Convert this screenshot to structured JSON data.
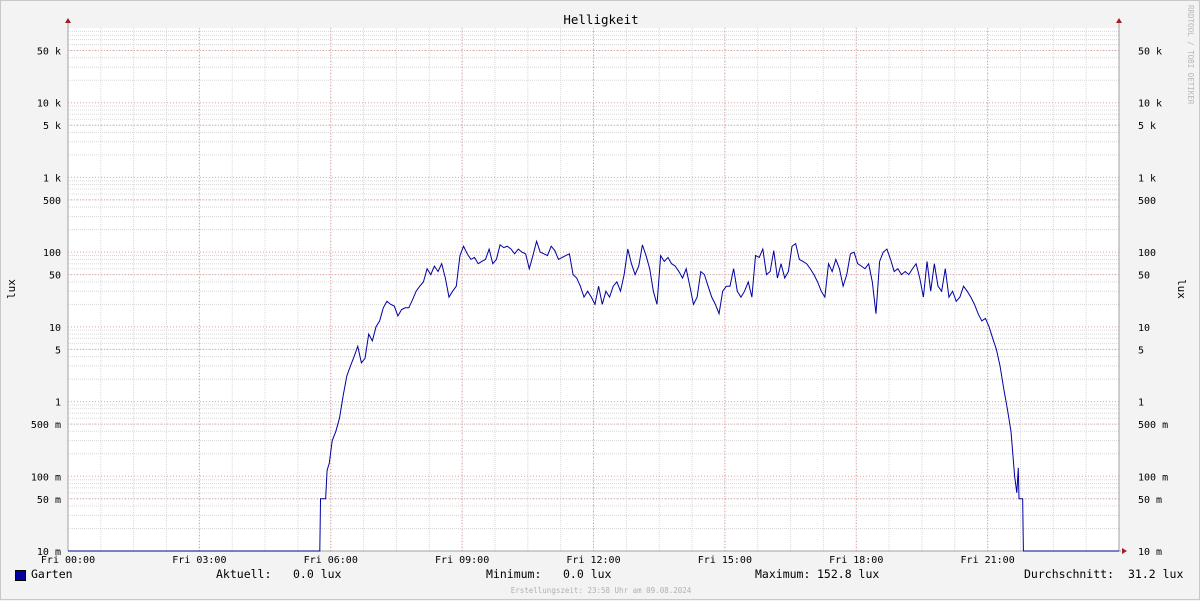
{
  "chart_data": {
    "type": "line",
    "title": "Helligkeit",
    "ylabel": "lux",
    "yscale": "log",
    "ylim": [
      0.01,
      100000
    ],
    "xlim": [
      "Fri 00:00",
      "Sat 00:00"
    ],
    "x_ticks": [
      "Fri 00:00",
      "Fri 03:00",
      "Fri 06:00",
      "Fri 09:00",
      "Fri 12:00",
      "Fri 15:00",
      "Fri 18:00",
      "Fri 21:00"
    ],
    "y_ticks": [
      {
        "value": 0.01,
        "label": "10 m"
      },
      {
        "value": 0.05,
        "label": "50 m"
      },
      {
        "value": 0.1,
        "label": "100 m"
      },
      {
        "value": 0.5,
        "label": "500 m"
      },
      {
        "value": 1,
        "label": "1"
      },
      {
        "value": 5,
        "label": "5"
      },
      {
        "value": 10,
        "label": "10"
      },
      {
        "value": 50,
        "label": "50"
      },
      {
        "value": 100,
        "label": "100"
      },
      {
        "value": 500,
        "label": "500"
      },
      {
        "value": 1000,
        "label": "1 k"
      },
      {
        "value": 5000,
        "label": "5 k"
      },
      {
        "value": 10000,
        "label": "10 k"
      },
      {
        "value": 50000,
        "label": "50 k"
      }
    ],
    "grid": true,
    "series": [
      {
        "name": "Garten",
        "color": "#0000a0",
        "points": [
          [
            "Fri 00:00",
            0.01
          ],
          [
            "Fri 03:00",
            0.01
          ],
          [
            "Fri 05:45",
            0.01
          ],
          [
            "Fri 05:46",
            0.05
          ],
          [
            "Fri 05:53",
            0.05
          ],
          [
            "Fri 05:55",
            0.12
          ],
          [
            "Fri 05:58",
            0.15
          ],
          [
            "Fri 06:02",
            0.3
          ],
          [
            "Fri 06:07",
            0.4
          ],
          [
            "Fri 06:12",
            0.6
          ],
          [
            "Fri 06:17",
            1.2
          ],
          [
            "Fri 06:22",
            2.2
          ],
          [
            "Fri 06:27",
            3.0
          ],
          [
            "Fri 06:32",
            4.0
          ],
          [
            "Fri 06:37",
            5.5
          ],
          [
            "Fri 06:42",
            3.3
          ],
          [
            "Fri 06:47",
            3.8
          ],
          [
            "Fri 06:52",
            8.0
          ],
          [
            "Fri 06:57",
            6.5
          ],
          [
            "Fri 07:02",
            10.0
          ],
          [
            "Fri 07:07",
            12.0
          ],
          [
            "Fri 07:12",
            18.0
          ],
          [
            "Fri 07:17",
            22.0
          ],
          [
            "Fri 07:22",
            20.0
          ],
          [
            "Fri 07:27",
            19.0
          ],
          [
            "Fri 07:32",
            14.0
          ],
          [
            "Fri 07:37",
            17.0
          ],
          [
            "Fri 07:42",
            18.0
          ],
          [
            "Fri 07:47",
            18.0
          ],
          [
            "Fri 07:52",
            23.0
          ],
          [
            "Fri 07:57",
            30.0
          ],
          [
            "Fri 08:02",
            35.0
          ],
          [
            "Fri 08:07",
            40.0
          ],
          [
            "Fri 08:12",
            60.0
          ],
          [
            "Fri 08:17",
            50.0
          ],
          [
            "Fri 08:22",
            65.0
          ],
          [
            "Fri 08:27",
            55.0
          ],
          [
            "Fri 08:32",
            70.0
          ],
          [
            "Fri 08:37",
            45.0
          ],
          [
            "Fri 08:42",
            25.0
          ],
          [
            "Fri 08:47",
            30.0
          ],
          [
            "Fri 08:52",
            35.0
          ],
          [
            "Fri 08:57",
            90.0
          ],
          [
            "Fri 09:02",
            120.0
          ],
          [
            "Fri 09:07",
            95.0
          ],
          [
            "Fri 09:12",
            80.0
          ],
          [
            "Fri 09:17",
            85.0
          ],
          [
            "Fri 09:22",
            70.0
          ],
          [
            "Fri 09:27",
            75.0
          ],
          [
            "Fri 09:32",
            80.0
          ],
          [
            "Fri 09:37",
            110.0
          ],
          [
            "Fri 09:42",
            70.0
          ],
          [
            "Fri 09:47",
            80.0
          ],
          [
            "Fri 09:52",
            125.0
          ],
          [
            "Fri 09:57",
            115.0
          ],
          [
            "Fri 10:02",
            120.0
          ],
          [
            "Fri 10:07",
            110.0
          ],
          [
            "Fri 10:12",
            95.0
          ],
          [
            "Fri 10:17",
            110.0
          ],
          [
            "Fri 10:22",
            100.0
          ],
          [
            "Fri 10:27",
            95.0
          ],
          [
            "Fri 10:32",
            60.0
          ],
          [
            "Fri 10:37",
            90.0
          ],
          [
            "Fri 10:42",
            140.0
          ],
          [
            "Fri 10:47",
            100.0
          ],
          [
            "Fri 10:52",
            95.0
          ],
          [
            "Fri 10:57",
            90.0
          ],
          [
            "Fri 11:02",
            120.0
          ],
          [
            "Fri 11:07",
            105.0
          ],
          [
            "Fri 11:12",
            80.0
          ],
          [
            "Fri 11:17",
            85.0
          ],
          [
            "Fri 11:22",
            90.0
          ],
          [
            "Fri 11:27",
            95.0
          ],
          [
            "Fri 11:32",
            50.0
          ],
          [
            "Fri 11:37",
            45.0
          ],
          [
            "Fri 11:42",
            35.0
          ],
          [
            "Fri 11:47",
            25.0
          ],
          [
            "Fri 11:52",
            30.0
          ],
          [
            "Fri 11:57",
            25.0
          ],
          [
            "Fri 12:02",
            20.0
          ],
          [
            "Fri 12:07",
            35.0
          ],
          [
            "Fri 12:12",
            20.0
          ],
          [
            "Fri 12:17",
            30.0
          ],
          [
            "Fri 12:22",
            25.0
          ],
          [
            "Fri 12:27",
            35.0
          ],
          [
            "Fri 12:32",
            40.0
          ],
          [
            "Fri 12:37",
            30.0
          ],
          [
            "Fri 12:42",
            50.0
          ],
          [
            "Fri 12:47",
            110.0
          ],
          [
            "Fri 12:52",
            70.0
          ],
          [
            "Fri 12:57",
            50.0
          ],
          [
            "Fri 13:02",
            65.0
          ],
          [
            "Fri 13:07",
            125.0
          ],
          [
            "Fri 13:12",
            90.0
          ],
          [
            "Fri 13:17",
            60.0
          ],
          [
            "Fri 13:22",
            30.0
          ],
          [
            "Fri 13:27",
            20.0
          ],
          [
            "Fri 13:32",
            90.0
          ],
          [
            "Fri 13:37",
            75.0
          ],
          [
            "Fri 13:42",
            85.0
          ],
          [
            "Fri 13:47",
            70.0
          ],
          [
            "Fri 13:52",
            65.0
          ],
          [
            "Fri 13:57",
            55.0
          ],
          [
            "Fri 14:02",
            45.0
          ],
          [
            "Fri 14:07",
            60.0
          ],
          [
            "Fri 14:12",
            35.0
          ],
          [
            "Fri 14:17",
            20.0
          ],
          [
            "Fri 14:22",
            25.0
          ],
          [
            "Fri 14:27",
            55.0
          ],
          [
            "Fri 14:32",
            50.0
          ],
          [
            "Fri 14:37",
            35.0
          ],
          [
            "Fri 14:42",
            25.0
          ],
          [
            "Fri 14:47",
            20.0
          ],
          [
            "Fri 14:52",
            15.0
          ],
          [
            "Fri 14:57",
            30.0
          ],
          [
            "Fri 15:02",
            35.0
          ],
          [
            "Fri 15:07",
            35.0
          ],
          [
            "Fri 15:12",
            60.0
          ],
          [
            "Fri 15:17",
            30.0
          ],
          [
            "Fri 15:22",
            25.0
          ],
          [
            "Fri 15:27",
            30.0
          ],
          [
            "Fri 15:32",
            40.0
          ],
          [
            "Fri 15:37",
            25.0
          ],
          [
            "Fri 15:42",
            90.0
          ],
          [
            "Fri 15:47",
            85.0
          ],
          [
            "Fri 15:52",
            110.0
          ],
          [
            "Fri 15:57",
            50.0
          ],
          [
            "Fri 16:02",
            55.0
          ],
          [
            "Fri 16:07",
            105.0
          ],
          [
            "Fri 16:12",
            45.0
          ],
          [
            "Fri 16:17",
            70.0
          ],
          [
            "Fri 16:22",
            45.0
          ],
          [
            "Fri 16:27",
            55.0
          ],
          [
            "Fri 16:32",
            120.0
          ],
          [
            "Fri 16:37",
            130.0
          ],
          [
            "Fri 16:42",
            80.0
          ],
          [
            "Fri 16:47",
            75.0
          ],
          [
            "Fri 16:52",
            70.0
          ],
          [
            "Fri 16:57",
            60.0
          ],
          [
            "Fri 17:02",
            50.0
          ],
          [
            "Fri 17:07",
            40.0
          ],
          [
            "Fri 17:12",
            30.0
          ],
          [
            "Fri 17:17",
            25.0
          ],
          [
            "Fri 17:22",
            70.0
          ],
          [
            "Fri 17:27",
            55.0
          ],
          [
            "Fri 17:32",
            80.0
          ],
          [
            "Fri 17:37",
            60.0
          ],
          [
            "Fri 17:42",
            35.0
          ],
          [
            "Fri 17:47",
            50.0
          ],
          [
            "Fri 17:52",
            95.0
          ],
          [
            "Fri 17:57",
            100.0
          ],
          [
            "Fri 18:02",
            70.0
          ],
          [
            "Fri 18:07",
            65.0
          ],
          [
            "Fri 18:12",
            60.0
          ],
          [
            "Fri 18:17",
            70.0
          ],
          [
            "Fri 18:22",
            40.0
          ],
          [
            "Fri 18:27",
            15.0
          ],
          [
            "Fri 18:32",
            75.0
          ],
          [
            "Fri 18:37",
            100.0
          ],
          [
            "Fri 18:42",
            110.0
          ],
          [
            "Fri 18:47",
            80.0
          ],
          [
            "Fri 18:52",
            55.0
          ],
          [
            "Fri 18:57",
            60.0
          ],
          [
            "Fri 19:02",
            50.0
          ],
          [
            "Fri 19:07",
            55.0
          ],
          [
            "Fri 19:12",
            50.0
          ],
          [
            "Fri 19:17",
            60.0
          ],
          [
            "Fri 19:22",
            70.0
          ],
          [
            "Fri 19:27",
            45.0
          ],
          [
            "Fri 19:32",
            25.0
          ],
          [
            "Fri 19:37",
            75.0
          ],
          [
            "Fri 19:42",
            30.0
          ],
          [
            "Fri 19:47",
            70.0
          ],
          [
            "Fri 19:52",
            35.0
          ],
          [
            "Fri 19:57",
            30.0
          ],
          [
            "Fri 20:02",
            60.0
          ],
          [
            "Fri 20:07",
            25.0
          ],
          [
            "Fri 20:12",
            30.0
          ],
          [
            "Fri 20:17",
            22.0
          ],
          [
            "Fri 20:22",
            25.0
          ],
          [
            "Fri 20:27",
            35.0
          ],
          [
            "Fri 20:32",
            30.0
          ],
          [
            "Fri 20:37",
            25.0
          ],
          [
            "Fri 20:42",
            20.0
          ],
          [
            "Fri 20:47",
            15.0
          ],
          [
            "Fri 20:52",
            12.0
          ],
          [
            "Fri 20:57",
            13.0
          ],
          [
            "Fri 21:02",
            10.0
          ],
          [
            "Fri 21:07",
            7.0
          ],
          [
            "Fri 21:12",
            5.0
          ],
          [
            "Fri 21:17",
            3.0
          ],
          [
            "Fri 21:22",
            1.5
          ],
          [
            "Fri 21:27",
            0.8
          ],
          [
            "Fri 21:32",
            0.4
          ],
          [
            "Fri 21:37",
            0.1
          ],
          [
            "Fri 21:40",
            0.06
          ],
          [
            "Fri 21:42",
            0.13
          ],
          [
            "Fri 21:43",
            0.05
          ],
          [
            "Fri 21:48",
            0.05
          ],
          [
            "Fri 21:49",
            0.01
          ],
          [
            "Sat 00:00",
            0.01
          ]
        ]
      }
    ]
  },
  "legend": {
    "series_name": "Garten",
    "series_color": "#0000a0",
    "current_label": "Aktuell:",
    "current_value": "0.0 lux",
    "min_label": "Minimum:",
    "min_value": "0.0 lux",
    "max_label": "Maximum:",
    "max_value": "152.8 lux",
    "avg_label": "Durchschnitt:",
    "avg_value": "31.2 lux"
  },
  "footer": "Erstellungszeit: 23:58 Uhr am 09.08.2024",
  "watermark": "RRDTOOL / TOBI OETIKER",
  "colors": {
    "background": "#f3f3f3",
    "plot_background": "#ffffff",
    "major_grid": "#e8a0a0",
    "minor_grid": "#d8d8d8",
    "axis": "#a0a0a0",
    "arrow": "#a02020"
  }
}
